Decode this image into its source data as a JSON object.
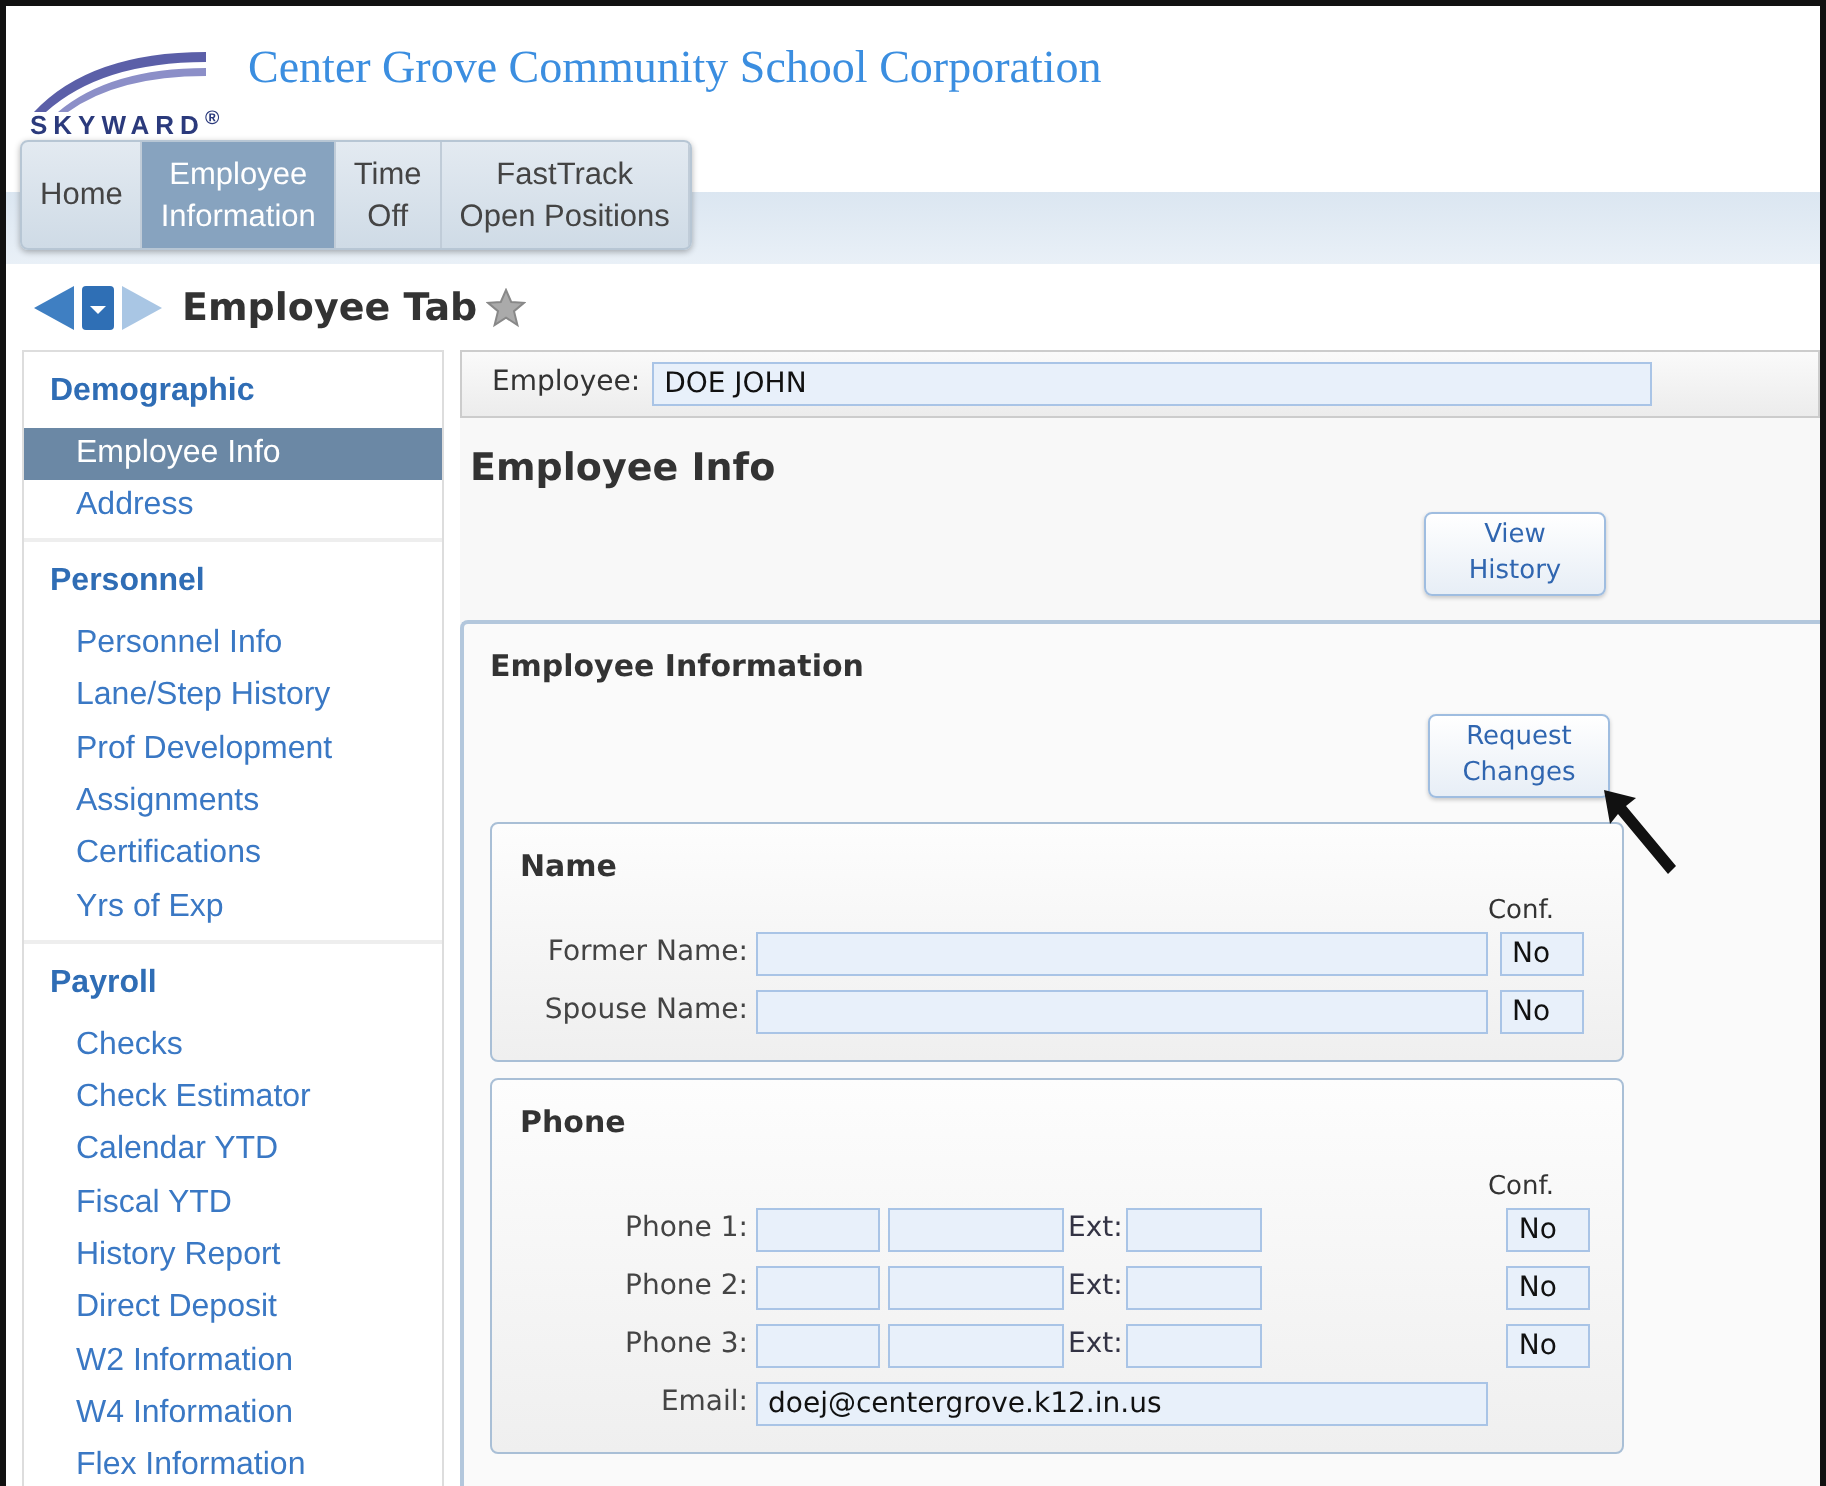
{
  "header": {
    "logo": "SKYWARD$^{®}$",
    "title": "Center Grove Community School Corporation"
  },
  "tabs": [
    {
      "lines": [
        "Home"
      ],
      "selected": false
    },
    {
      "lines": [
        "Employee",
        "Information"
      ],
      "selected": true
    },
    {
      "lines": [
        "Time",
        "Off"
      ],
      "selected": false
    },
    {
      "lines": [
        "FastTrack",
        "Open Positions"
      ],
      "selected": false
    }
  ],
  "page_title": "Employee Tab",
  "sidebar": {
    "sections": [
      {
        "title": "Demographic",
        "items": [
          {
            "label": "Employee Info",
            "selected": true
          },
          {
            "label": "Address",
            "selected": false
          }
        ]
      },
      {
        "title": "Personnel",
        "items": [
          {
            "label": "Personnel Info",
            "selected": false
          },
          {
            "label": "Lane/Step History",
            "selected": false
          },
          {
            "label": "Prof Development",
            "selected": false
          },
          {
            "label": "Assignments",
            "selected": false
          },
          {
            "label": "Certifications",
            "selected": false
          },
          {
            "label": "Yrs of Exp",
            "selected": false
          }
        ]
      },
      {
        "title": "Payroll",
        "items": [
          {
            "label": "Checks",
            "selected": false
          },
          {
            "label": "Check Estimator",
            "selected": false
          },
          {
            "label": "Calendar YTD",
            "selected": false
          },
          {
            "label": "Fiscal YTD",
            "selected": false
          },
          {
            "label": "History Report",
            "selected": false
          },
          {
            "label": "Direct Deposit",
            "selected": false
          },
          {
            "label": "W2 Information",
            "selected": false
          },
          {
            "label": "W4 Information",
            "selected": false
          },
          {
            "label": "Flex Information",
            "selected": false
          }
        ]
      }
    ]
  },
  "employee": {
    "label": "Employee:",
    "value": "DOE JOHN"
  },
  "heading": "Employee Info",
  "view_history_button": [
    "View",
    "History"
  ],
  "panel": {
    "title": "Employee Information",
    "request_button": [
      "Request",
      "Changes"
    ],
    "groups": [
      {
        "title": "Name",
        "conf_header": "Conf.",
        "rows": [
          {
            "kind": "text",
            "label": "Former Name:",
            "conf": "No"
          },
          {
            "kind": "text",
            "label": "Spouse Name:",
            "conf": "No"
          }
        ]
      },
      {
        "title": "Phone",
        "conf_header": "Conf.",
        "rows": [
          {
            "kind": "phone",
            "label": "Phone 1:",
            "ext_label": "Ext:",
            "conf": "No"
          },
          {
            "kind": "phone",
            "label": "Phone 2:",
            "ext_label": "Ext:",
            "conf": "No"
          },
          {
            "kind": "phone",
            "label": "Phone 3:",
            "ext_label": "Ext:",
            "conf": "No"
          },
          {
            "kind": "text",
            "label": "Email:",
            "value": "doej@centergrove.k12.in.us"
          }
        ]
      }
    ]
  }
}
